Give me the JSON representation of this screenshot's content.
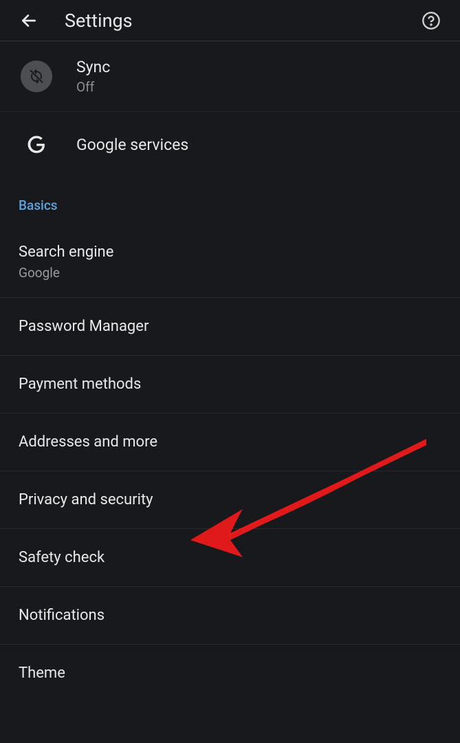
{
  "header": {
    "title": "Settings"
  },
  "account": {
    "sync": {
      "title": "Sync",
      "status": "Off"
    },
    "google": {
      "title": "Google services"
    }
  },
  "section": {
    "label": "Basics"
  },
  "items": {
    "searchEngine": {
      "title": "Search engine",
      "sub": "Google"
    },
    "passwordManager": {
      "title": "Password Manager"
    },
    "paymentMethods": {
      "title": "Payment methods"
    },
    "addresses": {
      "title": "Addresses and more"
    },
    "privacy": {
      "title": "Privacy and security"
    },
    "safety": {
      "title": "Safety check"
    },
    "notifications": {
      "title": "Notifications"
    },
    "theme": {
      "title": "Theme"
    }
  }
}
